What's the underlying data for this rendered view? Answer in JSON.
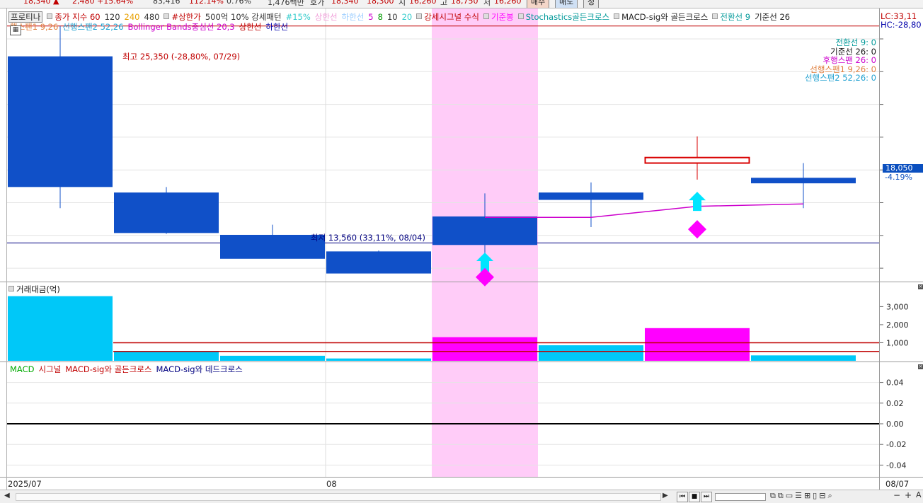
{
  "quote_bar": {
    "price": "18,340 ▲",
    "change": "2,480 +15.64%",
    "volume": "83,416",
    "volume_ratio": "112.14%",
    "turnover": "0.76%",
    "amount": "1,476백만",
    "ask_label": "호가",
    "ask": "18,340",
    "bid": "18,300",
    "open_label": "시",
    "open": "16,260",
    "high_label": "고",
    "high": "18,750",
    "low_label": "저",
    "low": "16,260",
    "buy_button": "매수",
    "sell_button": "매도",
    "extra_button": "정"
  },
  "legend_main": {
    "row1": [
      {
        "text": "프로티나",
        "color": "#222222",
        "boxed": true
      },
      {
        "text": "종가 지수 60",
        "color": "#c00000"
      },
      {
        "text": "120",
        "color": "#333333"
      },
      {
        "text": "240",
        "color": "#e8a000"
      },
      {
        "text": "480",
        "color": "#333333"
      },
      {
        "text": "#상한가",
        "color": "#c00000"
      },
      {
        "text": "500억 10% 강세패턴",
        "color": "#333333"
      },
      {
        "text": "#15%",
        "color": "#33cccc"
      },
      {
        "text": "상한선",
        "color": "#f09cd8"
      },
      {
        "text": "하한선",
        "color": "#99ccff"
      },
      {
        "text": "5",
        "color": "#cc00cc"
      },
      {
        "text": "8",
        "color": "#009900"
      },
      {
        "text": "10",
        "color": "#333333"
      },
      {
        "text": "20",
        "color": "#33cccc"
      },
      {
        "text": "강세시그널 수식",
        "color": "#c00000"
      },
      {
        "text": "기준봉",
        "color": "#ff00ff"
      },
      {
        "text": "Stochastics골든크로스",
        "color": "#009999"
      },
      {
        "text": "MACD-sig와 골든크로스",
        "color": "#222222"
      },
      {
        "text": "전환선 9",
        "color": "#009999"
      },
      {
        "text": "기준선 26",
        "color": "#222222"
      }
    ],
    "row2": [
      {
        "text": "행스팬1 9,26",
        "color": "#e08040"
      },
      {
        "text": "선행스팬2 52,26",
        "color": "#20a0d0"
      },
      {
        "text": "Bollinger Bands중심선 20,3",
        "color": "#cc00cc"
      },
      {
        "text": "상한선",
        "color": "#c00000"
      },
      {
        "text": "하한선",
        "color": "#0000aa"
      }
    ]
  },
  "ichimoku_values": [
    {
      "text": "전환선 9: 0",
      "color": "#009999"
    },
    {
      "text": "기준선 26: 0",
      "color": "#111111"
    },
    {
      "text": "후행스팬 26: 0",
      "color": "#cc00cc"
    },
    {
      "text": "선행스팬1 9,26: 0",
      "color": "#e08040"
    },
    {
      "text": "선행스팬2 52,26: 0",
      "color": "#20a0d0"
    }
  ],
  "right_info": {
    "lc": "LC:33,11",
    "hc": "HC:-28,80",
    "current_price_tag": "18,050",
    "current_change_tag": "-4.19%"
  },
  "annotations": {
    "high": "최고 25,350 (-28,80%, 07/29)",
    "low": "최저 13,560 (33,11%, 08/04)"
  },
  "chart_data": [
    {
      "type": "candlestick",
      "title": "프로티나",
      "highlight_candle_index": 4,
      "candles": [
        {
          "open": 23700,
          "high": 25350,
          "low": 15450,
          "close": 16600
        },
        {
          "open": 16300,
          "high": 16600,
          "low": 14050,
          "close": 14100
        },
        {
          "open": 14000,
          "high": 14550,
          "low": 13400,
          "close": 12700
        },
        {
          "open": 13100,
          "high": 13150,
          "low": 12550,
          "close": 11900
        },
        {
          "open": 15000,
          "high": 16250,
          "low": 12600,
          "close": 13450
        },
        {
          "open": 16300,
          "high": 16850,
          "low": 14420,
          "close": 15900
        },
        {
          "open": 17900,
          "high": 19350,
          "low": 17000,
          "close": 18200
        },
        {
          "open": 17100,
          "high": 17900,
          "low": 15450,
          "close": 16800
        }
      ],
      "line_series": [
        {
          "values": [
            null,
            null,
            null,
            null,
            14950,
            14950,
            15550,
            15680
          ],
          "color": "#cc00cc"
        }
      ],
      "reference_lines": [
        {
          "value": 25350,
          "color": "#c00000"
        },
        {
          "value": 13560,
          "color": "#000080"
        }
      ],
      "markers": [
        {
          "index": 4,
          "shape": "arrow-up",
          "color": "#00e5ff",
          "value": 12500
        },
        {
          "index": 4,
          "shape": "diamond",
          "color": "#ff00ff",
          "value": 11700
        },
        {
          "index": 6,
          "shape": "arrow-up",
          "color": "#00e5ff",
          "value": 15800
        },
        {
          "index": 6,
          "shape": "diamond",
          "color": "#ff00ff",
          "value": 14300
        }
      ],
      "ylim": [
        11500,
        26300
      ]
    },
    {
      "type": "bar",
      "title": "거래대금(억)",
      "values": [
        3580,
        530,
        280,
        130,
        1310,
        860,
        1810,
        300
      ],
      "colors": [
        "#00c8f8",
        "#00c8f8",
        "#00c8f8",
        "#00c8f8",
        "#ff00ff",
        "#00c8f8",
        "#ff00ff",
        "#00c8f8"
      ],
      "ylim": [
        0,
        3800
      ],
      "yticks": [
        "3,000",
        "2,000",
        "1,000"
      ],
      "reference_lines": [
        {
          "value": 1000,
          "color": "#c00000"
        },
        {
          "value": 520,
          "color": "#c00000"
        }
      ]
    },
    {
      "type": "line",
      "title": "MACD",
      "legend": [
        {
          "text": "MACD",
          "color": "#00aa00"
        },
        {
          "text": "시그널",
          "color": "#c00000"
        },
        {
          "text": "MACD-sig와 골든크로스",
          "color": "#c00000"
        },
        {
          "text": "MACD-sig와 데드크로스",
          "color": "#000080"
        }
      ],
      "values": [
        0,
        0,
        0,
        0,
        0,
        0,
        0,
        0
      ],
      "ylim": [
        -0.05,
        0.05
      ],
      "yticks": [
        "0.04",
        "0.02",
        "0.00",
        "-0.02",
        "-0.04"
      ]
    }
  ],
  "x_axis": {
    "labels": [
      "2025/07",
      "08",
      "08/07"
    ]
  }
}
